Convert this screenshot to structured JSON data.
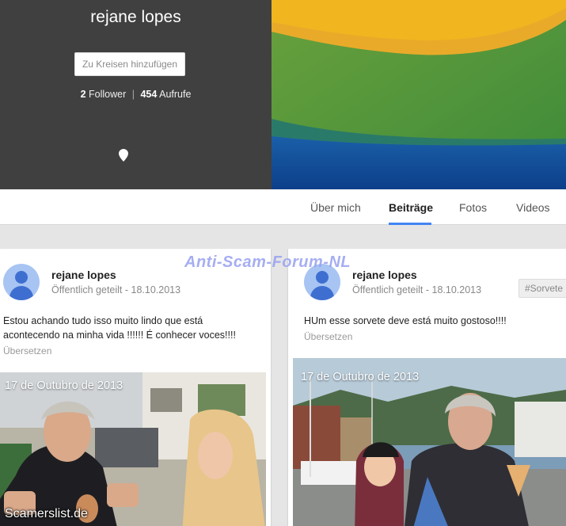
{
  "profile": {
    "name": "rejane lopes",
    "add_circle_label": "Zu Kreisen hinzufügen",
    "followers_count": "2",
    "followers_label": "Follower",
    "separator": "|",
    "views_count": "454",
    "views_label": "Aufrufe"
  },
  "tabs": [
    {
      "label": "Über mich",
      "active": false
    },
    {
      "label": "Beiträge",
      "active": true
    },
    {
      "label": "Fotos",
      "active": false
    },
    {
      "label": "Videos",
      "active": false
    }
  ],
  "posts": [
    {
      "author": "rejane lopes",
      "meta": "Öffentlich geteilt  -  18.10.2013",
      "text_line1": "Estou achando tudo isso muito lindo  que está",
      "text_line2": "acontecendo na minha vida !!!!!! É conhecer voces!!!!",
      "translate": "Übersetzen",
      "photo_caption": "17 de Outubro de 2013"
    },
    {
      "author": "rejane lopes",
      "meta": "Öffentlich geteilt  -  18.10.2013",
      "hashtag": "#Sorvete",
      "text_line1": "HUm esse sorvete deve está muito gostoso!!!!",
      "translate": "Übersetzen",
      "photo_caption": "17 de Outubro de 2013"
    }
  ],
  "watermarks": {
    "top": "Anti-Scam-Forum-NL",
    "bottom": "Scamerslist.de"
  },
  "colors": {
    "panel_bg": "#404040",
    "accent": "#4285f4",
    "watermark": "#969ff0"
  },
  "icons": [
    "location-pin-icon",
    "avatar-icon"
  ]
}
